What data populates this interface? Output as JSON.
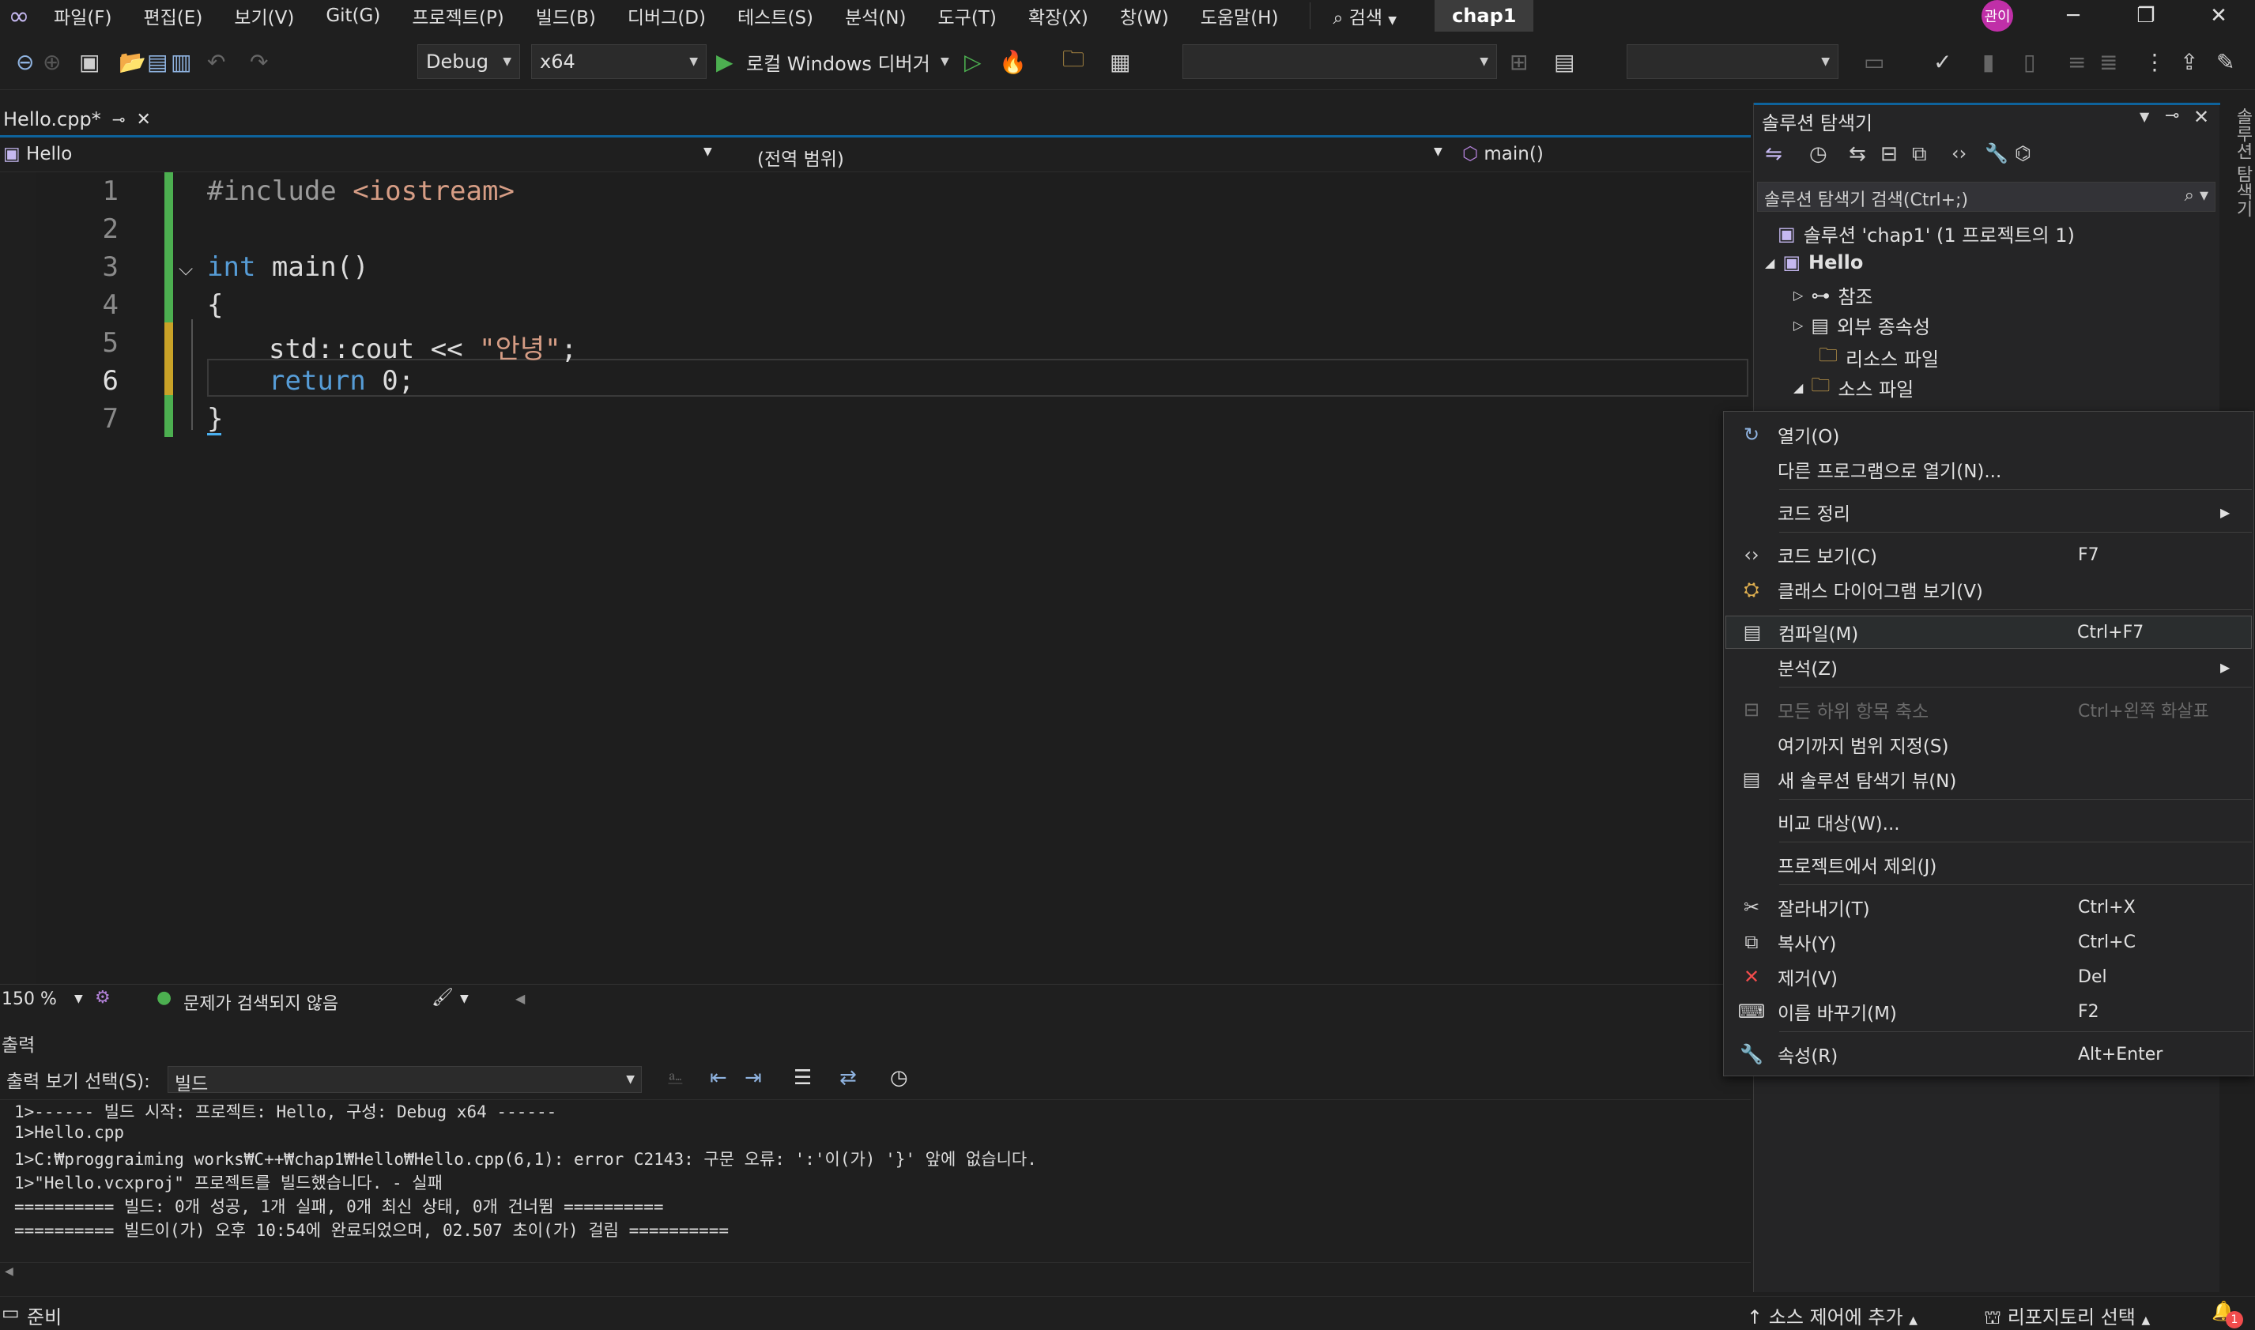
{
  "menubar": {
    "items": [
      "파일(F)",
      "편집(E)",
      "보기(V)",
      "Git(G)",
      "프로젝트(P)",
      "빌드(B)",
      "디버그(D)",
      "테스트(S)",
      "분석(N)",
      "도구(T)",
      "확장(X)",
      "창(W)",
      "도움말(H)"
    ],
    "search_label": "검색",
    "solution_name": "chap1",
    "avatar_text": "관이"
  },
  "toolbar": {
    "configuration": "Debug",
    "platform": "x64",
    "debugger_label": "로컬 Windows 디버거"
  },
  "editor": {
    "tab_title": "Hello.cpp*",
    "nav_project": "Hello",
    "nav_scope": "(전역 범위)",
    "nav_member": "main()",
    "line_numbers": [
      "1",
      "2",
      "3",
      "4",
      "5",
      "6",
      "7"
    ],
    "code": {
      "l1_pp": "#include ",
      "l1_inc": "<iostream>",
      "l3_kw": "int",
      "l3_rest": " main()",
      "l4": "{",
      "l5_a": "std::cout << ",
      "l5_str": "\"안녕\"",
      "l5_b": ";",
      "l6_kw": "return",
      "l6_rest": " 0;",
      "l7": "}"
    },
    "zoom": "150 %",
    "issues": "문제가 검색되지 않음"
  },
  "output": {
    "title": "출력",
    "show_from_label": "출력 보기 선택(S):",
    "show_from_value": "빌드",
    "lines": [
      "1>------ 빌드 시작: 프로젝트: Hello, 구성: Debug x64 ------",
      "1>Hello.cpp",
      "1>C:₩proggraiming works₩C++₩chap1₩Hello₩Hello.cpp(6,1): error C2143: 구문 오류: ':'이(가) '}' 앞에 없습니다.",
      "1>\"Hello.vcxproj\" 프로젝트를 빌드했습니다. - 실패",
      "========== 빌드: 0개 성공, 1개 실패, 0개 최신 상태, 0개 건너뜀 ==========",
      "========== 빌드이(가) 오후 10:54에 완료되었으며, 02.507 초이(가) 걸림 =========="
    ]
  },
  "solution_explorer": {
    "title": "솔루션 탐색기",
    "search_placeholder": "솔루션 탐색기 검색(Ctrl+;)",
    "solution_label": "솔루션 'chap1' (1 프로젝트의 1)",
    "project": "Hello",
    "nodes": [
      "참조",
      "외부 종속성",
      "리소스 파일",
      "소스 파일"
    ],
    "vertical_tab": "솔루션 탐색기"
  },
  "context_menu": {
    "items": [
      {
        "label": "열기(O)",
        "shortcut": ""
      },
      {
        "label": "다른 프로그램으로 열기(N)...",
        "shortcut": ""
      },
      {
        "label": "코드 정리",
        "shortcut": ""
      },
      {
        "label": "코드 보기(C)",
        "shortcut": "F7"
      },
      {
        "label": "클래스 다이어그램 보기(V)",
        "shortcut": ""
      },
      {
        "label": "컴파일(M)",
        "shortcut": "Ctrl+F7"
      },
      {
        "label": "분석(Z)",
        "shortcut": ""
      },
      {
        "label": "모든 하위 항목 축소",
        "shortcut": "Ctrl+왼쪽 화살표"
      },
      {
        "label": "여기까지 범위 지정(S)",
        "shortcut": ""
      },
      {
        "label": "새 솔루션 탐색기 뷰(N)",
        "shortcut": ""
      },
      {
        "label": "비교 대상(W)...",
        "shortcut": ""
      },
      {
        "label": "프로젝트에서 제외(J)",
        "shortcut": ""
      },
      {
        "label": "잘라내기(T)",
        "shortcut": "Ctrl+X"
      },
      {
        "label": "복사(Y)",
        "shortcut": "Ctrl+C"
      },
      {
        "label": "제거(V)",
        "shortcut": "Del"
      },
      {
        "label": "이름 바꾸기(M)",
        "shortcut": "F2"
      },
      {
        "label": "속성(R)",
        "shortcut": "Alt+Enter"
      }
    ]
  },
  "statusbar": {
    "ready": "준비",
    "add_source_control": "소스 제어에 추가",
    "select_repo": "리포지토리 선택",
    "notifications": "1"
  },
  "colors": {
    "accent": "#0e639c",
    "git_changed": "#4caf50",
    "keyword": "#569cd6",
    "string": "#d69d85",
    "error_red": "#f14c4c"
  }
}
